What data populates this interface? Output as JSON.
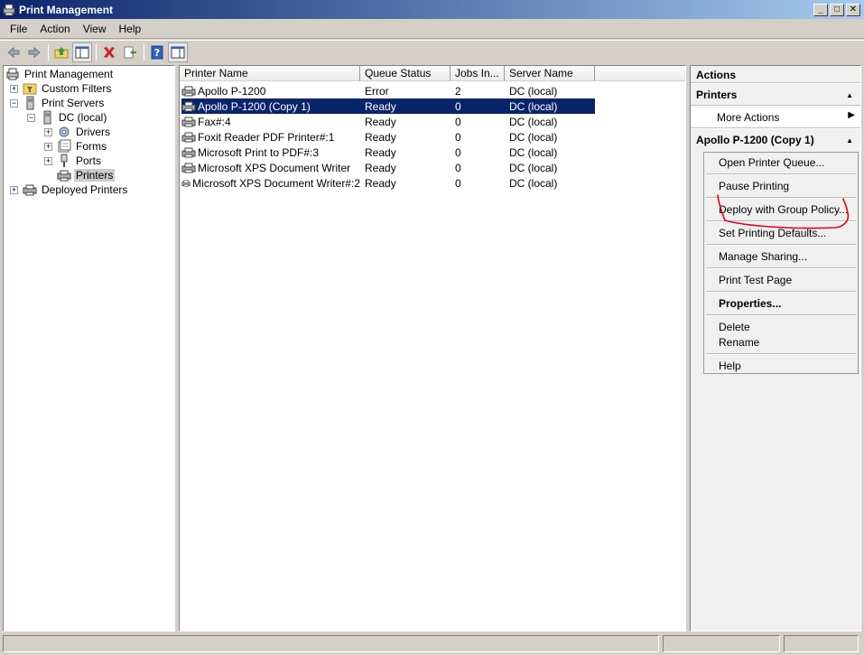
{
  "window": {
    "title": "Print Management",
    "controls": [
      "_",
      "□",
      "✕"
    ]
  },
  "menu": [
    "File",
    "Action",
    "View",
    "Help"
  ],
  "tree": {
    "root": "Print Management",
    "custom_filters": "Custom Filters",
    "print_servers": "Print Servers",
    "server": "DC (local)",
    "drivers": "Drivers",
    "forms": "Forms",
    "ports": "Ports",
    "printers": "Printers",
    "deployed_printers": "Deployed Printers"
  },
  "list": {
    "columns": [
      "Printer Name",
      "Queue Status",
      "Jobs In...",
      "Server Name"
    ],
    "rows": [
      {
        "name": "Apollo P-1200",
        "status": "Error",
        "jobs": "2",
        "server": "DC (local)"
      },
      {
        "name": "Apollo P-1200 (Copy 1)",
        "status": "Ready",
        "jobs": "0",
        "server": "DC (local)"
      },
      {
        "name": "Fax#:4",
        "status": "Ready",
        "jobs": "0",
        "server": "DC (local)"
      },
      {
        "name": "Foxit Reader PDF Printer#:1",
        "status": "Ready",
        "jobs": "0",
        "server": "DC (local)"
      },
      {
        "name": "Microsoft Print to PDF#:3",
        "status": "Ready",
        "jobs": "0",
        "server": "DC (local)"
      },
      {
        "name": "Microsoft XPS Document Writer",
        "status": "Ready",
        "jobs": "0",
        "server": "DC (local)"
      },
      {
        "name": "Microsoft XPS Document Writer#:2",
        "status": "Ready",
        "jobs": "0",
        "server": "DC (local)"
      }
    ]
  },
  "actions": {
    "title": "Actions",
    "printers_header": "Printers",
    "more_actions": "More Actions",
    "selected_header": "Apollo P-1200 (Copy 1)",
    "menu": {
      "open_queue": "Open Printer Queue...",
      "pause": "Pause Printing",
      "deploy": "Deploy with Group Policy...",
      "set_defaults": "Set Printing Defaults...",
      "manage_sharing": "Manage Sharing...",
      "print_test": "Print Test Page",
      "properties": "Properties...",
      "delete": "Delete",
      "rename": "Rename",
      "help": "Help"
    }
  },
  "colors": {
    "selection": "#0a246a",
    "annotation": "#e8001c"
  },
  "icons": [
    "back-icon",
    "forward-icon",
    "up-folder-icon",
    "console-tree-icon",
    "delete-icon",
    "export-icon",
    "help-icon",
    "properties-icon"
  ]
}
